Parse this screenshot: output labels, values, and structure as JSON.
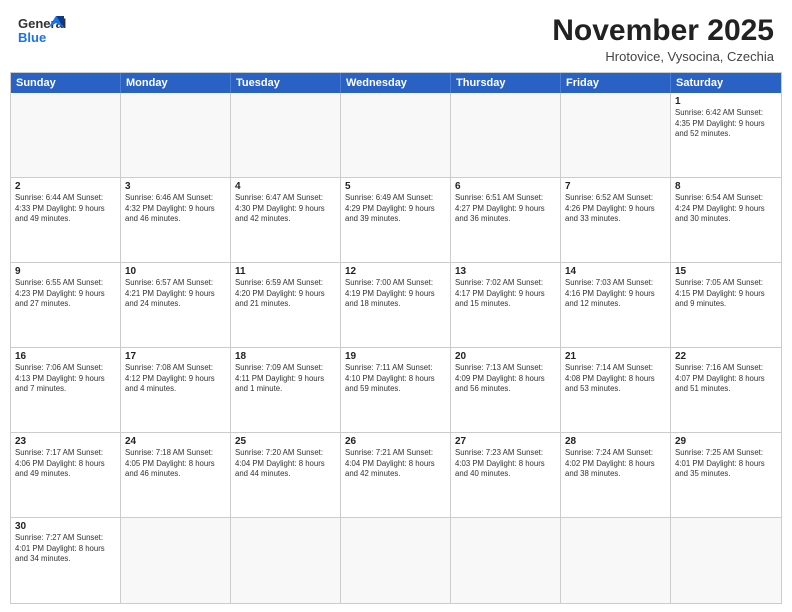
{
  "header": {
    "logo_general": "General",
    "logo_blue": "Blue",
    "month_title": "November 2025",
    "subtitle": "Hrotovice, Vysocina, Czechia"
  },
  "day_headers": [
    "Sunday",
    "Monday",
    "Tuesday",
    "Wednesday",
    "Thursday",
    "Friday",
    "Saturday"
  ],
  "weeks": [
    [
      {
        "day": "",
        "info": ""
      },
      {
        "day": "",
        "info": ""
      },
      {
        "day": "",
        "info": ""
      },
      {
        "day": "",
        "info": ""
      },
      {
        "day": "",
        "info": ""
      },
      {
        "day": "",
        "info": ""
      },
      {
        "day": "1",
        "info": "Sunrise: 6:42 AM\nSunset: 4:35 PM\nDaylight: 9 hours and 52 minutes."
      }
    ],
    [
      {
        "day": "2",
        "info": "Sunrise: 6:44 AM\nSunset: 4:33 PM\nDaylight: 9 hours and 49 minutes."
      },
      {
        "day": "3",
        "info": "Sunrise: 6:46 AM\nSunset: 4:32 PM\nDaylight: 9 hours and 46 minutes."
      },
      {
        "day": "4",
        "info": "Sunrise: 6:47 AM\nSunset: 4:30 PM\nDaylight: 9 hours and 42 minutes."
      },
      {
        "day": "5",
        "info": "Sunrise: 6:49 AM\nSunset: 4:29 PM\nDaylight: 9 hours and 39 minutes."
      },
      {
        "day": "6",
        "info": "Sunrise: 6:51 AM\nSunset: 4:27 PM\nDaylight: 9 hours and 36 minutes."
      },
      {
        "day": "7",
        "info": "Sunrise: 6:52 AM\nSunset: 4:26 PM\nDaylight: 9 hours and 33 minutes."
      },
      {
        "day": "8",
        "info": "Sunrise: 6:54 AM\nSunset: 4:24 PM\nDaylight: 9 hours and 30 minutes."
      }
    ],
    [
      {
        "day": "9",
        "info": "Sunrise: 6:55 AM\nSunset: 4:23 PM\nDaylight: 9 hours and 27 minutes."
      },
      {
        "day": "10",
        "info": "Sunrise: 6:57 AM\nSunset: 4:21 PM\nDaylight: 9 hours and 24 minutes."
      },
      {
        "day": "11",
        "info": "Sunrise: 6:59 AM\nSunset: 4:20 PM\nDaylight: 9 hours and 21 minutes."
      },
      {
        "day": "12",
        "info": "Sunrise: 7:00 AM\nSunset: 4:19 PM\nDaylight: 9 hours and 18 minutes."
      },
      {
        "day": "13",
        "info": "Sunrise: 7:02 AM\nSunset: 4:17 PM\nDaylight: 9 hours and 15 minutes."
      },
      {
        "day": "14",
        "info": "Sunrise: 7:03 AM\nSunset: 4:16 PM\nDaylight: 9 hours and 12 minutes."
      },
      {
        "day": "15",
        "info": "Sunrise: 7:05 AM\nSunset: 4:15 PM\nDaylight: 9 hours and 9 minutes."
      }
    ],
    [
      {
        "day": "16",
        "info": "Sunrise: 7:06 AM\nSunset: 4:13 PM\nDaylight: 9 hours and 7 minutes."
      },
      {
        "day": "17",
        "info": "Sunrise: 7:08 AM\nSunset: 4:12 PM\nDaylight: 9 hours and 4 minutes."
      },
      {
        "day": "18",
        "info": "Sunrise: 7:09 AM\nSunset: 4:11 PM\nDaylight: 9 hours and 1 minute."
      },
      {
        "day": "19",
        "info": "Sunrise: 7:11 AM\nSunset: 4:10 PM\nDaylight: 8 hours and 59 minutes."
      },
      {
        "day": "20",
        "info": "Sunrise: 7:13 AM\nSunset: 4:09 PM\nDaylight: 8 hours and 56 minutes."
      },
      {
        "day": "21",
        "info": "Sunrise: 7:14 AM\nSunset: 4:08 PM\nDaylight: 8 hours and 53 minutes."
      },
      {
        "day": "22",
        "info": "Sunrise: 7:16 AM\nSunset: 4:07 PM\nDaylight: 8 hours and 51 minutes."
      }
    ],
    [
      {
        "day": "23",
        "info": "Sunrise: 7:17 AM\nSunset: 4:06 PM\nDaylight: 8 hours and 49 minutes."
      },
      {
        "day": "24",
        "info": "Sunrise: 7:18 AM\nSunset: 4:05 PM\nDaylight: 8 hours and 46 minutes."
      },
      {
        "day": "25",
        "info": "Sunrise: 7:20 AM\nSunset: 4:04 PM\nDaylight: 8 hours and 44 minutes."
      },
      {
        "day": "26",
        "info": "Sunrise: 7:21 AM\nSunset: 4:04 PM\nDaylight: 8 hours and 42 minutes."
      },
      {
        "day": "27",
        "info": "Sunrise: 7:23 AM\nSunset: 4:03 PM\nDaylight: 8 hours and 40 minutes."
      },
      {
        "day": "28",
        "info": "Sunrise: 7:24 AM\nSunset: 4:02 PM\nDaylight: 8 hours and 38 minutes."
      },
      {
        "day": "29",
        "info": "Sunrise: 7:25 AM\nSunset: 4:01 PM\nDaylight: 8 hours and 35 minutes."
      }
    ],
    [
      {
        "day": "30",
        "info": "Sunrise: 7:27 AM\nSunset: 4:01 PM\nDaylight: 8 hours and 34 minutes."
      },
      {
        "day": "",
        "info": ""
      },
      {
        "day": "",
        "info": ""
      },
      {
        "day": "",
        "info": ""
      },
      {
        "day": "",
        "info": ""
      },
      {
        "day": "",
        "info": ""
      },
      {
        "day": "",
        "info": ""
      }
    ]
  ]
}
